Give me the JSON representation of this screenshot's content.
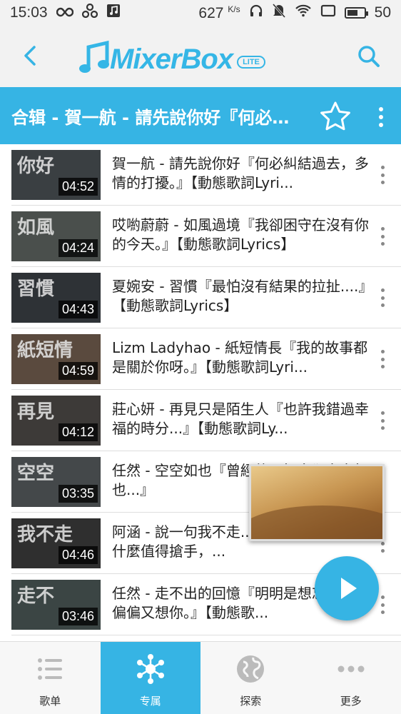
{
  "status_bar": {
    "time": "15:03",
    "speed": "627",
    "speed_unit": "K/s",
    "battery": "50"
  },
  "header": {
    "logo_text": "MixerBox",
    "logo_badge": "LITE"
  },
  "playlist": {
    "title": "合辑 - 賀一航 - 請先說你好『何必糾..."
  },
  "songs": [
    {
      "title": "賀一航 - 請先說你好『何必糾結過去，多情的打擾。』【動態歌詞Lyri...",
      "duration": "04:52",
      "thumb_text": "你好"
    },
    {
      "title": "哎喲蔚蔚 - 如風過境『我卻困守在沒有你的今天。』【動態歌詞Lyrics】",
      "duration": "04:24",
      "thumb_text": "如風"
    },
    {
      "title": "夏婉安 - 習慣『最怕沒有結果的拉扯....』【動態歌詞Lyrics】",
      "duration": "04:43",
      "thumb_text": "習慣"
    },
    {
      "title": "Lizm Ladyhao - 紙短情長『我的故事都是關於你呀。』【動態歌詞Lyri...",
      "duration": "04:59",
      "thumb_text": "紙短情"
    },
    {
      "title": "莊心妍 - 再見只是陌生人『也許我錯過幸福的時分...』【動態歌詞Ly...",
      "duration": "04:12",
      "thumb_text": "再見"
    },
    {
      "title": "任然 - 空空如也『曾經的...如今卻空空如也...』",
      "duration": "03:35",
      "thumb_text": "空空"
    },
    {
      "title": "阿涵 - 說一句我不走...五）『問自己還有什麼值得搶手，...",
      "duration": "04:46",
      "thumb_text": "我不走"
    },
    {
      "title": "任然 - 走不出的回憶『明明是想忘記，卻偏偏又想你。』【動態歌...",
      "duration": "03:46",
      "thumb_text": "走不"
    }
  ],
  "nav": {
    "tabs": [
      {
        "label": "歌单",
        "icon": "list-icon"
      },
      {
        "label": "专属",
        "icon": "network-icon"
      },
      {
        "label": "探索",
        "icon": "globe-icon"
      },
      {
        "label": "更多",
        "icon": "more-dots-icon"
      }
    ],
    "active": 1
  },
  "colors": {
    "accent": "#36b4e4"
  }
}
